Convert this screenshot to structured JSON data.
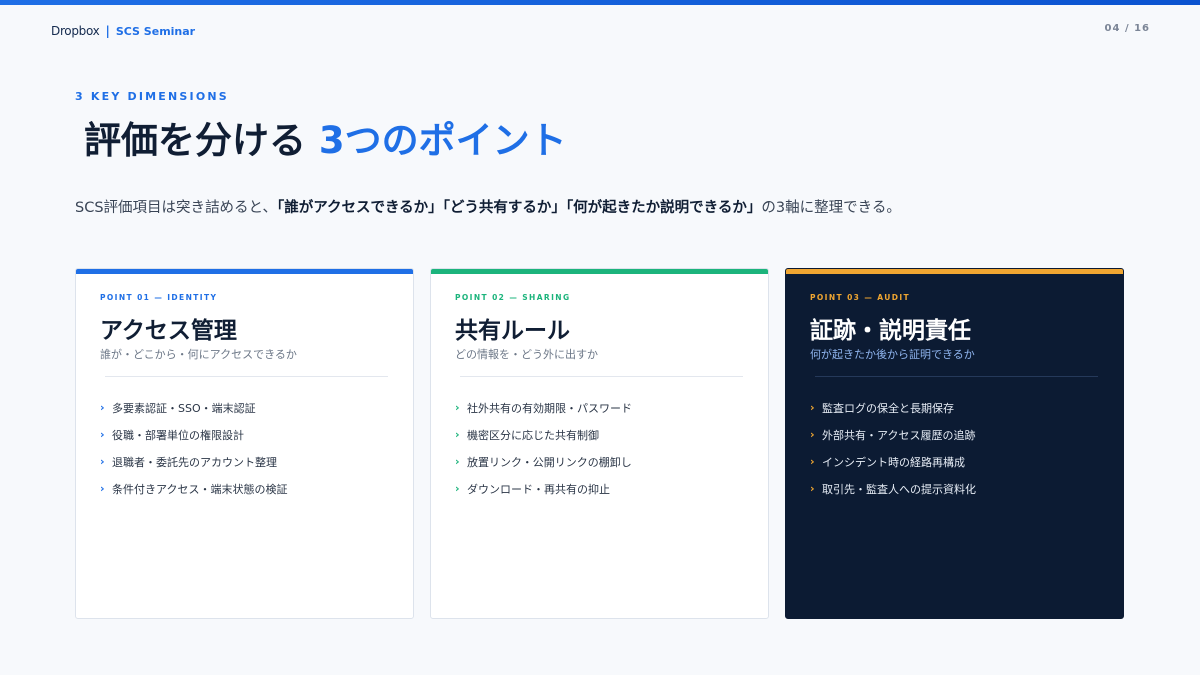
{
  "header": {
    "brand": "Dropbox",
    "separator": "|",
    "seminar": "SCS Seminar",
    "page_number": "04 / 16"
  },
  "eyebrow": "3 KEY DIMENSIONS",
  "title": {
    "main": "評価を分ける",
    "accent": "3つのポイント"
  },
  "lead": {
    "intro": "SCS評価項目は突き詰めると、",
    "q1": "「誰がアクセスできるか」",
    "q2": "「どう共有するか」",
    "q3": "「何が起きたか説明できるか」",
    "outro": "の3軸に整理できる。"
  },
  "colors": {
    "brand_blue": "#1f6fe6",
    "green": "#1cb47c",
    "orange": "#f0a631",
    "navy": "#0c1b33"
  },
  "cards": [
    {
      "label": "POINT 01 — IDENTITY",
      "heading": "アクセス管理",
      "sub": "誰が・どこから・何にアクセスできるか",
      "items": [
        "多要素認証・SSO・端末認証",
        "役職・部署単位の権限設計",
        "退職者・委託先のアカウント整理",
        "条件付きアクセス・端末状態の検証"
      ]
    },
    {
      "label": "POINT 02 — SHARING",
      "heading": "共有ルール",
      "sub": "どの情報を・どう外に出すか",
      "items": [
        "社外共有の有効期限・パスワード",
        "機密区分に応じた共有制御",
        "放置リンク・公開リンクの棚卸し",
        "ダウンロード・再共有の抑止"
      ]
    },
    {
      "label": "POINT 03 — AUDIT",
      "heading": "証跡・説明責任",
      "sub": "何が起きたか後から証明できるか",
      "items": [
        "監査ログの保全と長期保存",
        "外部共有・アクセス履歴の追跡",
        "インシデント時の経路再構成",
        "取引先・監査人への提示資料化"
      ]
    }
  ],
  "chevron": "›"
}
